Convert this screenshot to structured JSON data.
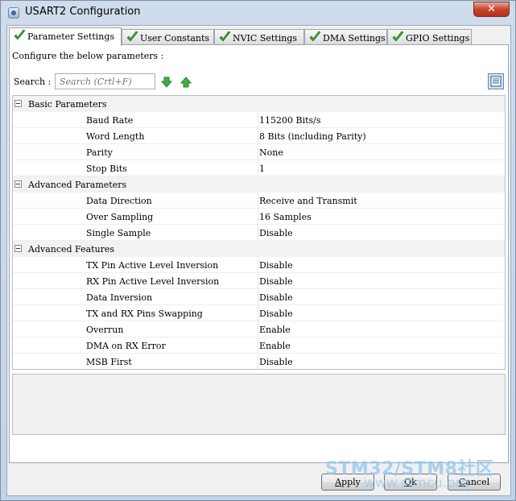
{
  "window": {
    "title": "USART2 Configuration",
    "close_label": "✕"
  },
  "tabs": [
    {
      "label": "Parameter Settings",
      "active": true
    },
    {
      "label": "User Constants",
      "active": false
    },
    {
      "label": "NVIC Settings",
      "active": false
    },
    {
      "label": "DMA Settings",
      "active": false
    },
    {
      "label": "GPIO Settings",
      "active": false
    }
  ],
  "panel": {
    "configure_text": "Configure the below parameters :",
    "search_label": "Search :",
    "search_placeholder": "Search (Crtl+F)"
  },
  "groups": [
    {
      "label": "Basic Parameters",
      "params": [
        {
          "name": "Baud Rate",
          "value": "115200 Bits/s"
        },
        {
          "name": "Word Length",
          "value": "8 Bits (including Parity)"
        },
        {
          "name": "Parity",
          "value": "None"
        },
        {
          "name": "Stop Bits",
          "value": "1"
        }
      ]
    },
    {
      "label": "Advanced Parameters",
      "params": [
        {
          "name": "Data Direction",
          "value": "Receive and Transmit"
        },
        {
          "name": "Over Sampling",
          "value": "16 Samples"
        },
        {
          "name": "Single Sample",
          "value": "Disable"
        }
      ]
    },
    {
      "label": "Advanced Features",
      "params": [
        {
          "name": "TX Pin Active Level Inversion",
          "value": "Disable"
        },
        {
          "name": "RX Pin Active Level Inversion",
          "value": "Disable"
        },
        {
          "name": "Data Inversion",
          "value": "Disable"
        },
        {
          "name": "TX and RX Pins Swapping",
          "value": "Disable"
        },
        {
          "name": "Overrun",
          "value": "Enable"
        },
        {
          "name": "DMA on RX Error",
          "value": "Enable"
        },
        {
          "name": "MSB First",
          "value": "Disable"
        }
      ]
    }
  ],
  "buttons": {
    "apply": {
      "mnemonic": "A",
      "rest": "pply"
    },
    "ok": {
      "mnemonic": "O",
      "rest": "k"
    },
    "cancel": {
      "mnemonic": "C",
      "rest": "ancel"
    }
  },
  "watermark": {
    "main": "STM32/STM8社区",
    "sub": "www.stmcu.org"
  },
  "colors": {
    "check_green": "#3aa52e",
    "arrow_green": "#3cb043",
    "watermark": "#8fc6ee"
  }
}
